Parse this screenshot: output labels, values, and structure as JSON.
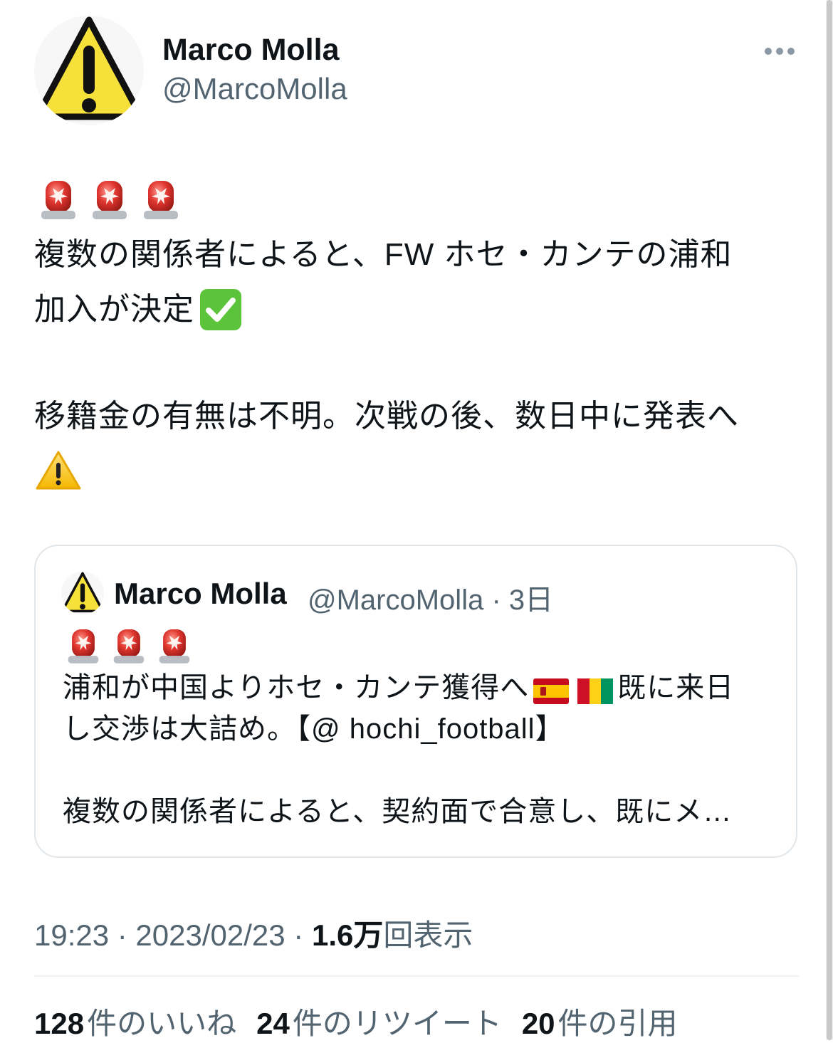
{
  "author": {
    "name": "Marco Molla",
    "handle": "@MarcoMolla",
    "avatar_icon": "warning-sign-icon"
  },
  "more_icon": "more-horizontal-icon",
  "tweet": {
    "lead_emoji": [
      "police-car-light-icon",
      "police-car-light-icon",
      "police-car-light-icon"
    ],
    "line1": "複数の関係者によると、FW ホセ・カンテの浦和",
    "line2": "加入が決定",
    "line2_emoji": "check-mark-button-icon",
    "line3": "移籍金の有無は不明。次戦の後、数日中に発表へ",
    "line4_emoji": "warning-icon"
  },
  "quoted": {
    "name": "Marco Molla",
    "handle_time": "@MarcoMolla · 3日",
    "lead_emoji": [
      "police-car-light-icon",
      "police-car-light-icon",
      "police-car-light-icon"
    ],
    "line1_a": "浦和が中国よりホセ・カンテ獲得へ",
    "flags": [
      "spain-flag-icon",
      "guinea-flag-icon"
    ],
    "line1_b": "既に来日",
    "line2": "し交渉は大詰め。【@ hochi_football】",
    "line3": "複数の関係者によると、契約面で合意し、既にメ…"
  },
  "meta": {
    "time_date": "19:23 · 2023/02/23 · ",
    "views": "1.6万",
    "views_label": "回表示"
  },
  "stats": {
    "likes_count": "128",
    "likes_label": "件のいいね",
    "retweets_count": "24",
    "retweets_label": "件のリツイート",
    "quotes_count": "20",
    "quotes_label": "件の引用"
  },
  "colors": {
    "text": "#0f1419",
    "secondary": "#536471",
    "border": "#e1e6ea",
    "warning_yellow": "#f6e03a",
    "siren_red": "#e0362f",
    "check_green": "#5cc43b"
  }
}
